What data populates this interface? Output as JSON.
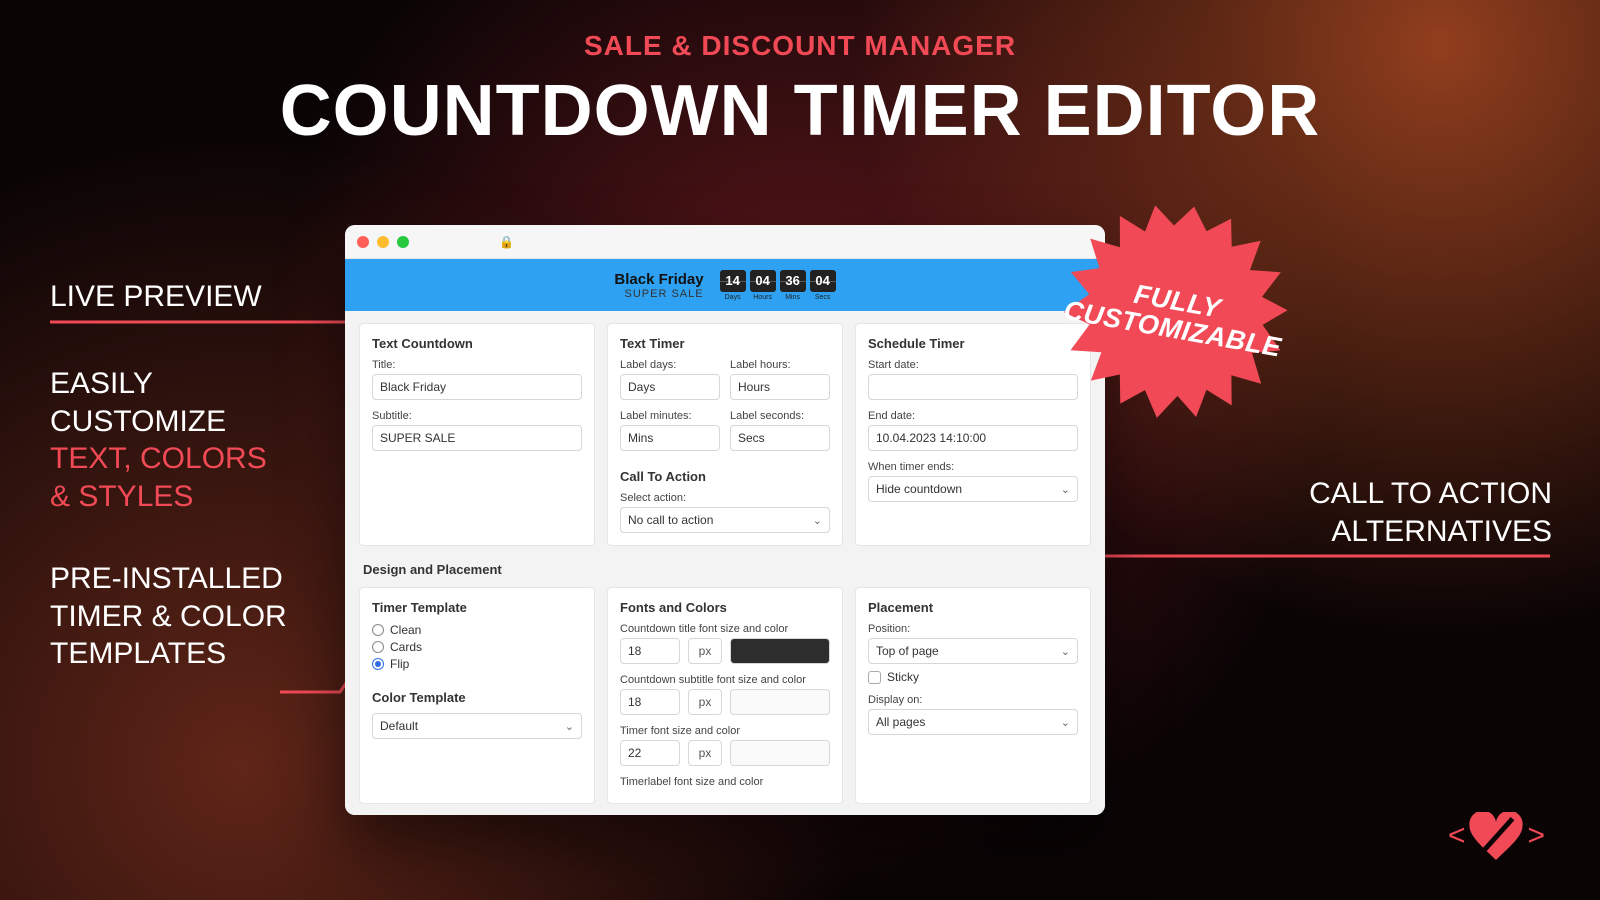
{
  "hero": {
    "overline": "SALE & DISCOUNT MANAGER",
    "title": "COUNTDOWN TIMER EDITOR"
  },
  "callouts": {
    "live": "LIVE PREVIEW",
    "customize_l1": "EASILY",
    "customize_l2": "CUSTOMIZE",
    "customize_accent1": "TEXT, COLORS",
    "customize_accent2": "& STYLES",
    "templates_l1": "PRE-INSTALLED",
    "templates_l2": "TIMER & COLOR",
    "templates_l3": "TEMPLATES",
    "cta_l1": "CALL TO ACTION",
    "cta_l2": "ALTERNATIVES"
  },
  "badge": {
    "l1": "FULLY",
    "l2": "CUSTOMIZABLE"
  },
  "banner": {
    "title": "Black Friday",
    "subtitle": "SUPER SALE",
    "segments": [
      {
        "value": "14",
        "label": "Days"
      },
      {
        "value": "04",
        "label": "Hours"
      },
      {
        "value": "36",
        "label": "Mins"
      },
      {
        "value": "04",
        "label": "Secs"
      }
    ]
  },
  "panels": {
    "text_countdown": {
      "title": "Text Countdown",
      "title_lbl": "Title:",
      "title_val": "Black Friday",
      "subtitle_lbl": "Subtitle:",
      "subtitle_val": "SUPER SALE"
    },
    "text_timer": {
      "title": "Text Timer",
      "days_lbl": "Label days:",
      "days_val": "Days",
      "hours_lbl": "Label hours:",
      "hours_val": "Hours",
      "mins_lbl": "Label minutes:",
      "mins_val": "Mins",
      "secs_lbl": "Label seconds:",
      "secs_val": "Secs"
    },
    "cta": {
      "title": "Call To Action",
      "select_lbl": "Select action:",
      "select_val": "No call to action"
    },
    "schedule": {
      "title": "Schedule Timer",
      "start_lbl": "Start date:",
      "start_val": "",
      "end_lbl": "End date:",
      "end_val": "10.04.2023 14:10:00",
      "ends_lbl": "When timer ends:",
      "ends_val": "Hide countdown"
    },
    "design_section": "Design and Placement",
    "template": {
      "title": "Timer Template",
      "options": [
        "Clean",
        "Cards",
        "Flip"
      ],
      "selected": "Flip",
      "color_title": "Color Template",
      "color_val": "Default"
    },
    "fonts": {
      "title": "Fonts and Colors",
      "r1_lbl": "Countdown title font size and color",
      "r1_size": "18",
      "r2_lbl": "Countdown subtitle font size and color",
      "r2_size": "18",
      "r3_lbl": "Timer font size and color",
      "r3_size": "22",
      "r4_lbl": "Timerlabel font size and color",
      "px": "px"
    },
    "placement": {
      "title": "Placement",
      "pos_lbl": "Position:",
      "pos_val": "Top of page",
      "sticky_lbl": "Sticky",
      "display_lbl": "Display on:",
      "display_val": "All pages"
    }
  }
}
